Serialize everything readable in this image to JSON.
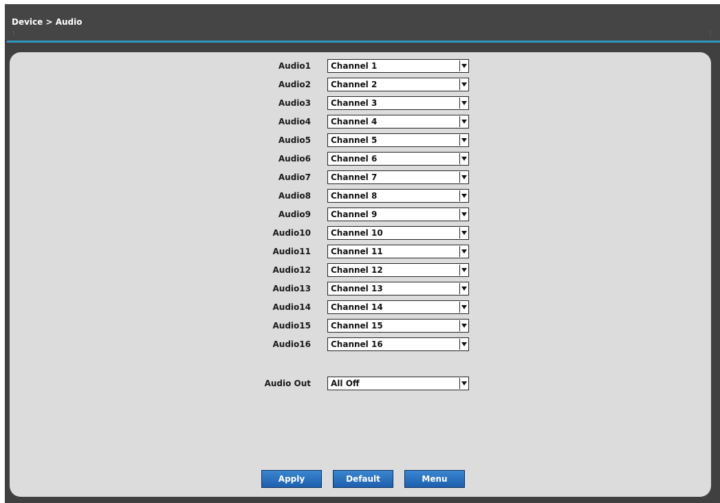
{
  "header": {
    "breadcrumb": "Device > Audio"
  },
  "audio_rows": [
    {
      "label": "Audio1",
      "value": "Channel 1"
    },
    {
      "label": "Audio2",
      "value": "Channel 2"
    },
    {
      "label": "Audio3",
      "value": "Channel 3"
    },
    {
      "label": "Audio4",
      "value": "Channel 4"
    },
    {
      "label": "Audio5",
      "value": "Channel 5"
    },
    {
      "label": "Audio6",
      "value": "Channel 6"
    },
    {
      "label": "Audio7",
      "value": "Channel 7"
    },
    {
      "label": "Audio8",
      "value": "Channel 8"
    },
    {
      "label": "Audio9",
      "value": "Channel 9"
    },
    {
      "label": "Audio10",
      "value": "Channel 10"
    },
    {
      "label": "Audio11",
      "value": "Channel 11"
    },
    {
      "label": "Audio12",
      "value": "Channel 12"
    },
    {
      "label": "Audio13",
      "value": "Channel 13"
    },
    {
      "label": "Audio14",
      "value": "Channel 14"
    },
    {
      "label": "Audio15",
      "value": "Channel 15"
    },
    {
      "label": "Audio16",
      "value": "Channel 16"
    }
  ],
  "audio_out": {
    "label": "Audio Out",
    "value": "All Off"
  },
  "buttons": {
    "apply": "Apply",
    "default": "Default",
    "menu": "Menu"
  },
  "colors": {
    "accent": "#2f9bc3",
    "panel": "#dcdcdc",
    "button": "#2a6fc0",
    "header": "#454545"
  },
  "icons": {
    "dropdown": "chevron-down-icon",
    "grip": "resize-grip-icon"
  }
}
